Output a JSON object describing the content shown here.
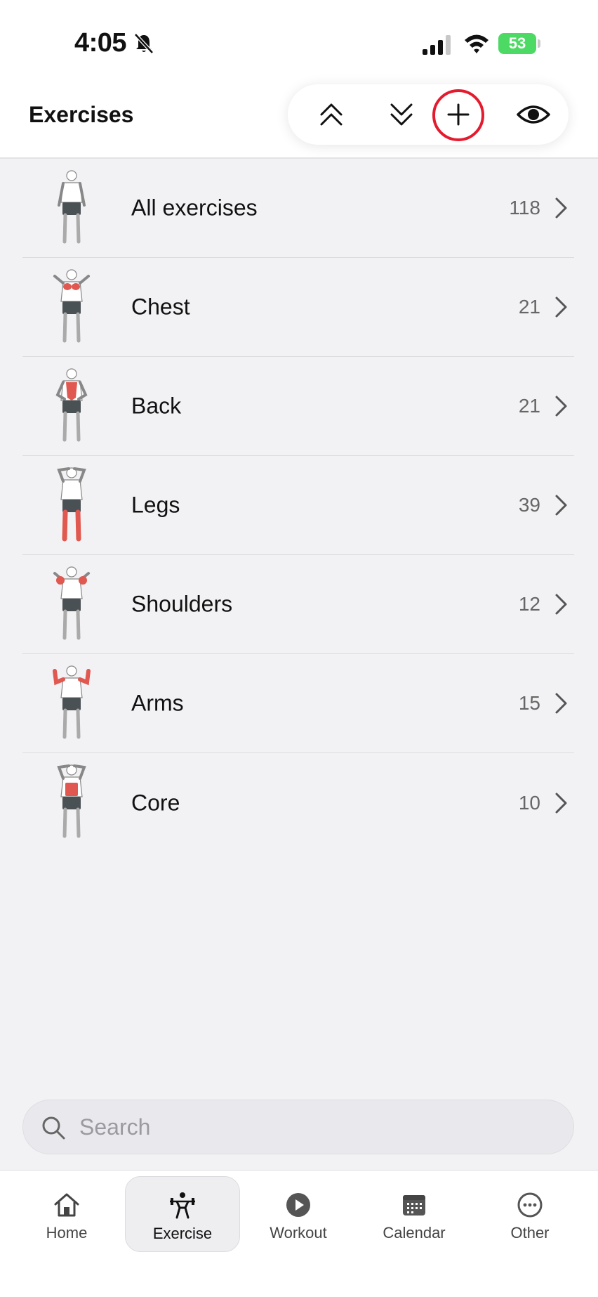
{
  "status_bar": {
    "time": "4:05",
    "battery": "53"
  },
  "header": {
    "title": "Exercises"
  },
  "toolbar": {
    "icons": [
      "chevrons-up-icon",
      "chevrons-down-icon",
      "plus-icon",
      "eye-icon"
    ]
  },
  "categories": [
    {
      "label": "All exercises",
      "count": "118"
    },
    {
      "label": "Chest",
      "count": "21"
    },
    {
      "label": "Back",
      "count": "21"
    },
    {
      "label": "Legs",
      "count": "39"
    },
    {
      "label": "Shoulders",
      "count": "12"
    },
    {
      "label": "Arms",
      "count": "15"
    },
    {
      "label": "Core",
      "count": "10"
    }
  ],
  "search": {
    "placeholder": "Search"
  },
  "tabs": [
    {
      "label": "Home"
    },
    {
      "label": "Exercise"
    },
    {
      "label": "Workout"
    },
    {
      "label": "Calendar"
    },
    {
      "label": "Other"
    }
  ],
  "colors": {
    "highlight": "#e41b2e",
    "muscle": "#e0584f",
    "battery": "#4cd964"
  }
}
